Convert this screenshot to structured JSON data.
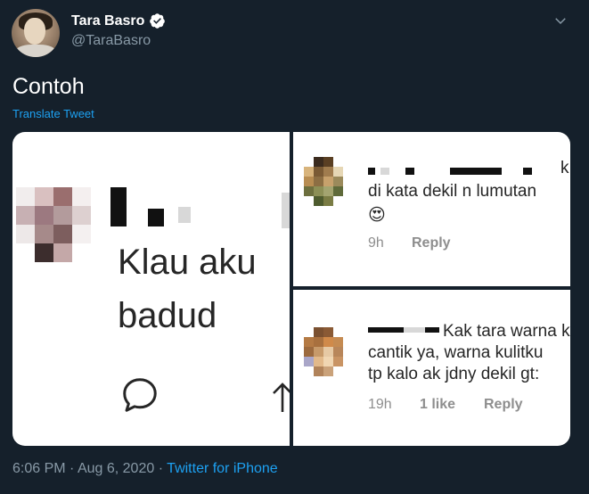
{
  "author": {
    "name": "Tara Basro",
    "handle": "@TaraBasro"
  },
  "tweet": {
    "text": "Contoh",
    "translate_label": "Translate Tweet",
    "time": "6:06 PM",
    "separator1": "·",
    "date": "Aug 6, 2020",
    "separator2": "·",
    "source": "Twitter for iPhone"
  },
  "media": {
    "left_panel": {
      "line1": "Klau aku",
      "line2": "badud"
    },
    "right_top": {
      "comment": "di kata dekil n lumutan",
      "emoji": "😍",
      "time": "9h",
      "reply": "Reply",
      "username_tail": "k"
    },
    "right_bottom": {
      "line1": "Kak tara warna k",
      "line2": "cantik ya, warna kulitku",
      "line3": "tp kalo ak jdny dekil gt:",
      "time": "19h",
      "likes": "1 like",
      "reply": "Reply"
    }
  },
  "colors": {
    "background": "#15202b",
    "link": "#1da1f2",
    "muted": "#8899a6"
  },
  "icons": {
    "verified": "verified-badge-icon",
    "caret": "chevron-down-icon",
    "comment": "comment-bubble-icon",
    "share": "share-arrow-icon"
  }
}
